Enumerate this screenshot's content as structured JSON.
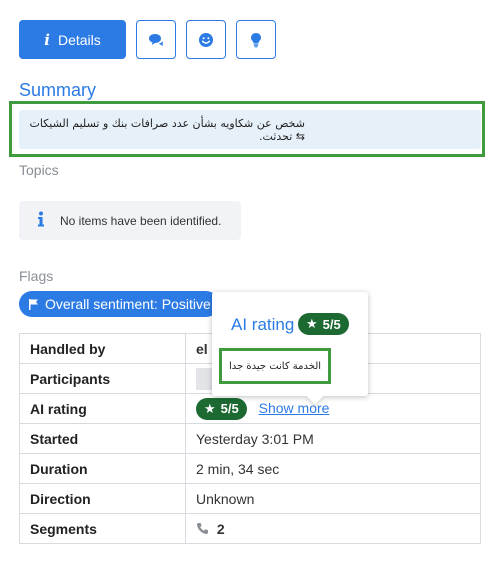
{
  "toolbar": {
    "details_label": "Details",
    "tabs": [
      {
        "icon": "comments-icon"
      },
      {
        "icon": "smile-icon"
      },
      {
        "icon": "lightbulb-icon"
      }
    ]
  },
  "summary": {
    "title": "Summary",
    "text": "شخص عن شكاويه بشأن عدد صرافات بنك و تسليم الشيكات ⇆ تحدثت."
  },
  "topics": {
    "title": "Topics",
    "empty_message": "No items have been identified."
  },
  "flags": {
    "title": "Flags",
    "pill_label": "Overall sentiment: Positive"
  },
  "details_table": {
    "rows": [
      {
        "label": "Handled by",
        "value": "el"
      },
      {
        "label": "Participants",
        "value": ""
      },
      {
        "label": "AI rating",
        "value": "5/5",
        "link": "Show more"
      },
      {
        "label": "Started",
        "value": "Yesterday 3:01 PM"
      },
      {
        "label": "Duration",
        "value": "2 min, 34 sec"
      },
      {
        "label": "Direction",
        "value": "Unknown"
      },
      {
        "label": "Segments",
        "value": "2"
      }
    ]
  },
  "popover": {
    "title": "AI rating",
    "rating": "5/5",
    "comment": "الخدمة كانت جيدة جدا"
  },
  "colors": {
    "accent": "#2c7be5",
    "highlight_border": "#3f9b3e",
    "rating_badge": "#1c6a32"
  }
}
